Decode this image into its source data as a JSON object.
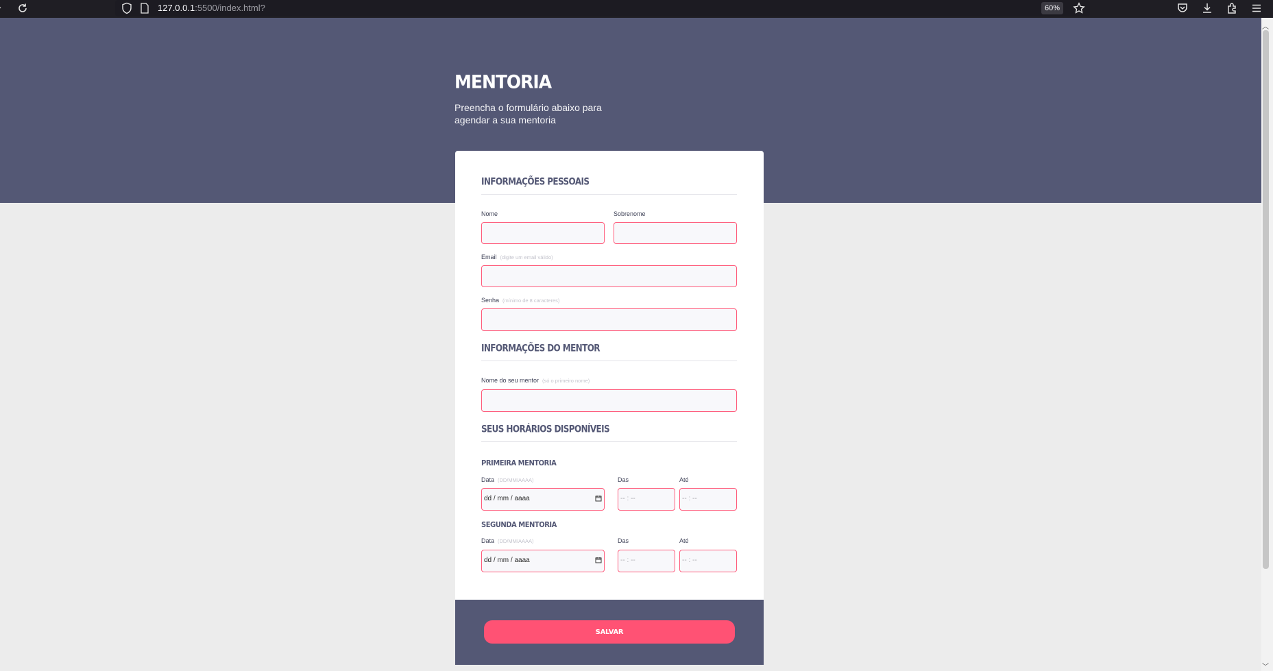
{
  "browser": {
    "url_host": "127.0.0.1",
    "url_rest": ":5500/index.html?",
    "zoom": "60%"
  },
  "hero": {
    "title": "MENTORIA",
    "subtitle": "Preencha o formulário abaixo para agendar a sua mentoria"
  },
  "personal": {
    "title": "INFORMAÇÕES PESSOAIS",
    "name_label": "Nome",
    "surname_label": "Sobrenome",
    "email_label": "Email",
    "email_hint": "(digite um email válido)",
    "password_label": "Senha",
    "password_hint": "(mínimo de 8 caracteres)"
  },
  "mentor": {
    "title": "INFORMAÇÕES DO MENTOR",
    "name_label": "Nome do seu mentor",
    "name_hint": "(só o primeiro nome)"
  },
  "schedule": {
    "title": "SEUS HORÁRIOS DISPONÍVEIS",
    "sessions": [
      {
        "title": "PRIMEIRA MENTORIA",
        "date_label": "Data",
        "date_hint": "(DD/MM/AAAA)",
        "date_placeholder": "dd / mm / aaaa",
        "from_label": "Das",
        "to_label": "Até",
        "time_placeholder": "-- : --"
      },
      {
        "title": "SEGUNDA MENTORIA",
        "date_label": "Data",
        "date_hint": "(DD/MM/AAAA)",
        "date_placeholder": "dd / mm / aaaa",
        "from_label": "Das",
        "to_label": "Até",
        "time_placeholder": "-- : --"
      }
    ]
  },
  "footer": {
    "save_label": "SALVAR"
  },
  "colors": {
    "primary": "#545875",
    "accent": "#ff5274",
    "background": "#ececec"
  },
  "icons": [
    "reload-icon",
    "shield-icon",
    "page-icon",
    "star-icon",
    "pocket-icon",
    "download-icon",
    "extensions-icon",
    "menu-icon",
    "calendar-icon"
  ]
}
